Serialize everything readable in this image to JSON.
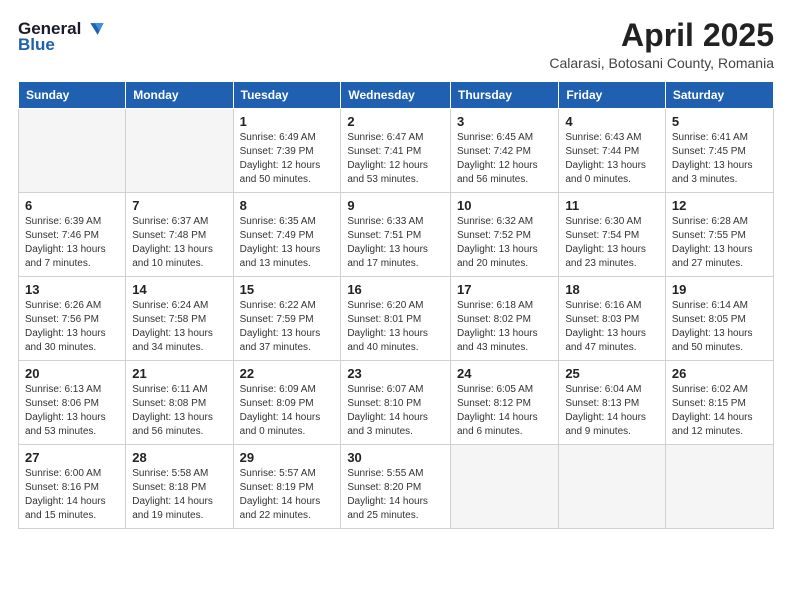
{
  "header": {
    "logo_general": "General",
    "logo_blue": "Blue",
    "title": "April 2025",
    "subtitle": "Calarasi, Botosani County, Romania"
  },
  "weekdays": [
    "Sunday",
    "Monday",
    "Tuesday",
    "Wednesday",
    "Thursday",
    "Friday",
    "Saturday"
  ],
  "weeks": [
    [
      {
        "day": "",
        "sunrise": "",
        "sunset": "",
        "daylight": "",
        "empty": true
      },
      {
        "day": "",
        "sunrise": "",
        "sunset": "",
        "daylight": "",
        "empty": true
      },
      {
        "day": "1",
        "sunrise": "Sunrise: 6:49 AM",
        "sunset": "Sunset: 7:39 PM",
        "daylight": "Daylight: 12 hours and 50 minutes."
      },
      {
        "day": "2",
        "sunrise": "Sunrise: 6:47 AM",
        "sunset": "Sunset: 7:41 PM",
        "daylight": "Daylight: 12 hours and 53 minutes."
      },
      {
        "day": "3",
        "sunrise": "Sunrise: 6:45 AM",
        "sunset": "Sunset: 7:42 PM",
        "daylight": "Daylight: 12 hours and 56 minutes."
      },
      {
        "day": "4",
        "sunrise": "Sunrise: 6:43 AM",
        "sunset": "Sunset: 7:44 PM",
        "daylight": "Daylight: 13 hours and 0 minutes."
      },
      {
        "day": "5",
        "sunrise": "Sunrise: 6:41 AM",
        "sunset": "Sunset: 7:45 PM",
        "daylight": "Daylight: 13 hours and 3 minutes."
      }
    ],
    [
      {
        "day": "6",
        "sunrise": "Sunrise: 6:39 AM",
        "sunset": "Sunset: 7:46 PM",
        "daylight": "Daylight: 13 hours and 7 minutes."
      },
      {
        "day": "7",
        "sunrise": "Sunrise: 6:37 AM",
        "sunset": "Sunset: 7:48 PM",
        "daylight": "Daylight: 13 hours and 10 minutes."
      },
      {
        "day": "8",
        "sunrise": "Sunrise: 6:35 AM",
        "sunset": "Sunset: 7:49 PM",
        "daylight": "Daylight: 13 hours and 13 minutes."
      },
      {
        "day": "9",
        "sunrise": "Sunrise: 6:33 AM",
        "sunset": "Sunset: 7:51 PM",
        "daylight": "Daylight: 13 hours and 17 minutes."
      },
      {
        "day": "10",
        "sunrise": "Sunrise: 6:32 AM",
        "sunset": "Sunset: 7:52 PM",
        "daylight": "Daylight: 13 hours and 20 minutes."
      },
      {
        "day": "11",
        "sunrise": "Sunrise: 6:30 AM",
        "sunset": "Sunset: 7:54 PM",
        "daylight": "Daylight: 13 hours and 23 minutes."
      },
      {
        "day": "12",
        "sunrise": "Sunrise: 6:28 AM",
        "sunset": "Sunset: 7:55 PM",
        "daylight": "Daylight: 13 hours and 27 minutes."
      }
    ],
    [
      {
        "day": "13",
        "sunrise": "Sunrise: 6:26 AM",
        "sunset": "Sunset: 7:56 PM",
        "daylight": "Daylight: 13 hours and 30 minutes."
      },
      {
        "day": "14",
        "sunrise": "Sunrise: 6:24 AM",
        "sunset": "Sunset: 7:58 PM",
        "daylight": "Daylight: 13 hours and 34 minutes."
      },
      {
        "day": "15",
        "sunrise": "Sunrise: 6:22 AM",
        "sunset": "Sunset: 7:59 PM",
        "daylight": "Daylight: 13 hours and 37 minutes."
      },
      {
        "day": "16",
        "sunrise": "Sunrise: 6:20 AM",
        "sunset": "Sunset: 8:01 PM",
        "daylight": "Daylight: 13 hours and 40 minutes."
      },
      {
        "day": "17",
        "sunrise": "Sunrise: 6:18 AM",
        "sunset": "Sunset: 8:02 PM",
        "daylight": "Daylight: 13 hours and 43 minutes."
      },
      {
        "day": "18",
        "sunrise": "Sunrise: 6:16 AM",
        "sunset": "Sunset: 8:03 PM",
        "daylight": "Daylight: 13 hours and 47 minutes."
      },
      {
        "day": "19",
        "sunrise": "Sunrise: 6:14 AM",
        "sunset": "Sunset: 8:05 PM",
        "daylight": "Daylight: 13 hours and 50 minutes."
      }
    ],
    [
      {
        "day": "20",
        "sunrise": "Sunrise: 6:13 AM",
        "sunset": "Sunset: 8:06 PM",
        "daylight": "Daylight: 13 hours and 53 minutes."
      },
      {
        "day": "21",
        "sunrise": "Sunrise: 6:11 AM",
        "sunset": "Sunset: 8:08 PM",
        "daylight": "Daylight: 13 hours and 56 minutes."
      },
      {
        "day": "22",
        "sunrise": "Sunrise: 6:09 AM",
        "sunset": "Sunset: 8:09 PM",
        "daylight": "Daylight: 14 hours and 0 minutes."
      },
      {
        "day": "23",
        "sunrise": "Sunrise: 6:07 AM",
        "sunset": "Sunset: 8:10 PM",
        "daylight": "Daylight: 14 hours and 3 minutes."
      },
      {
        "day": "24",
        "sunrise": "Sunrise: 6:05 AM",
        "sunset": "Sunset: 8:12 PM",
        "daylight": "Daylight: 14 hours and 6 minutes."
      },
      {
        "day": "25",
        "sunrise": "Sunrise: 6:04 AM",
        "sunset": "Sunset: 8:13 PM",
        "daylight": "Daylight: 14 hours and 9 minutes."
      },
      {
        "day": "26",
        "sunrise": "Sunrise: 6:02 AM",
        "sunset": "Sunset: 8:15 PM",
        "daylight": "Daylight: 14 hours and 12 minutes."
      }
    ],
    [
      {
        "day": "27",
        "sunrise": "Sunrise: 6:00 AM",
        "sunset": "Sunset: 8:16 PM",
        "daylight": "Daylight: 14 hours and 15 minutes."
      },
      {
        "day": "28",
        "sunrise": "Sunrise: 5:58 AM",
        "sunset": "Sunset: 8:18 PM",
        "daylight": "Daylight: 14 hours and 19 minutes."
      },
      {
        "day": "29",
        "sunrise": "Sunrise: 5:57 AM",
        "sunset": "Sunset: 8:19 PM",
        "daylight": "Daylight: 14 hours and 22 minutes."
      },
      {
        "day": "30",
        "sunrise": "Sunrise: 5:55 AM",
        "sunset": "Sunset: 8:20 PM",
        "daylight": "Daylight: 14 hours and 25 minutes."
      },
      {
        "day": "",
        "sunrise": "",
        "sunset": "",
        "daylight": "",
        "empty": true
      },
      {
        "day": "",
        "sunrise": "",
        "sunset": "",
        "daylight": "",
        "empty": true
      },
      {
        "day": "",
        "sunrise": "",
        "sunset": "",
        "daylight": "",
        "empty": true
      }
    ]
  ]
}
